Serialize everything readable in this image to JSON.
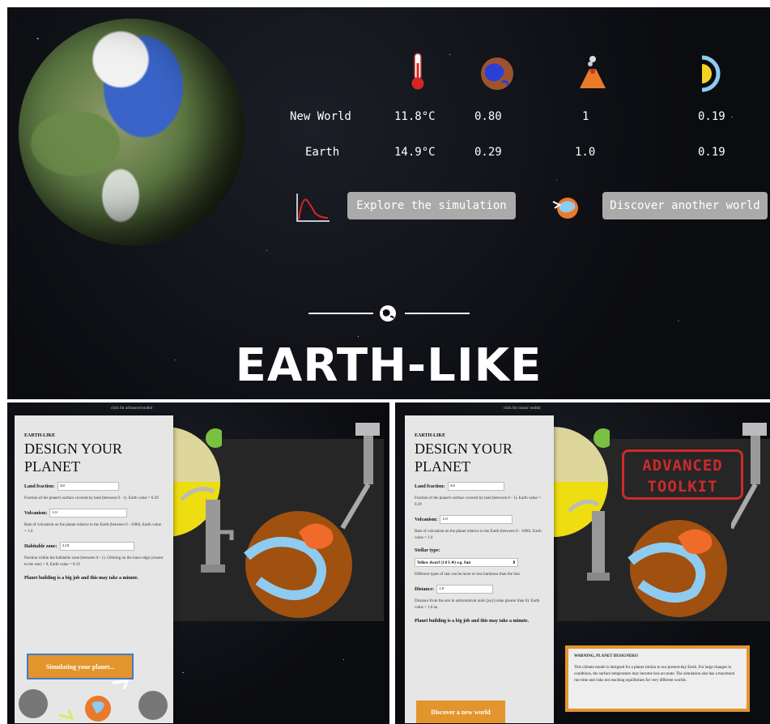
{
  "summary": {
    "rows": [
      {
        "name": "New World",
        "temperature": "11.8°C",
        "land_fraction": "0.80",
        "volcanism": "1",
        "habitable_zone": "0.19"
      },
      {
        "name": "Earth",
        "temperature": "14.9°C",
        "land_fraction": "0.29",
        "volcanism": "1.0",
        "habitable_zone": "0.19"
      }
    ],
    "explore_label": "Explore the simulation",
    "discover_label": "Discover another world",
    "brand": "EARTH-LIKE"
  },
  "left": {
    "top_link": "click for advanced toolkit",
    "eyebrow": "EARTH-LIKE",
    "title": "DESIGN YOUR PLANET",
    "land_label": "Land fraction:",
    "land_value": "0.8",
    "land_help": "Fraction of the planet's surface covered by land (between 0 - 1). Earth value = 0.29",
    "volc_label": "Volcanism:",
    "volc_value": "1.0",
    "volc_help": "Rate of volcanism on the planet relative to the Earth (between 0 - 1000). Earth value = 1.0",
    "hab_label": "Habitable zone:",
    "hab_value": "0.19",
    "hab_help": "Position within the habitable zone (between 0 - 1). Orbiting on the inner edge (closest to the star) = 0, Earth value = 0.19",
    "note": "Planet building is a big job and this may take a minute.",
    "button": "Simulating your planet..."
  },
  "right": {
    "top_link": "click for classic toolkit",
    "eyebrow": "EARTH-LIKE",
    "title": "DESIGN YOUR PLANET",
    "land_label": "Land fraction:",
    "land_value": "0.8",
    "land_help": "Fraction of the planet's surface covered by land (between 0 - 1). Earth value = 0.29",
    "volc_label": "Volcanism:",
    "volc_value": "1.0",
    "volc_help": "Rate of volcanism on the planet relative to the Earth (between 0 - 1000). Earth value = 1.0",
    "stellar_label": "Stellar type:",
    "stellar_value": "Yellow dwarf (1.0 L☀) e.g. Sun",
    "stellar_help": "Different types of star can be more or less luminous than the Sun.",
    "dist_label": "Distance:",
    "dist_value": "1.0",
    "dist_help": "Distance from the star in astronomical units [au] (value greater than 0). Earth value = 1.0 au",
    "note": "Planet building is a big job and this may take a minute.",
    "button": "Discover a new world",
    "stamp": "ADVANCED TOOLKIT",
    "warning_title": "WARNING, PLANET DESIGNERS!",
    "warning_text": "This climate model is designed for a planet similar to our present-day Earth. For large changes in conditions, the surface temperature may become less accurate. The simulation also has a maximum run-time and risks not reaching equilibrium for very different worlds."
  },
  "icons": [
    "thermometer-icon",
    "land-globe-icon",
    "volcano-icon",
    "habitable-zone-icon",
    "chart-icon",
    "world-swap-icon",
    "globe-icon",
    "sun-icon",
    "pump-icon",
    "faucet-icon",
    "recycle-icon"
  ]
}
